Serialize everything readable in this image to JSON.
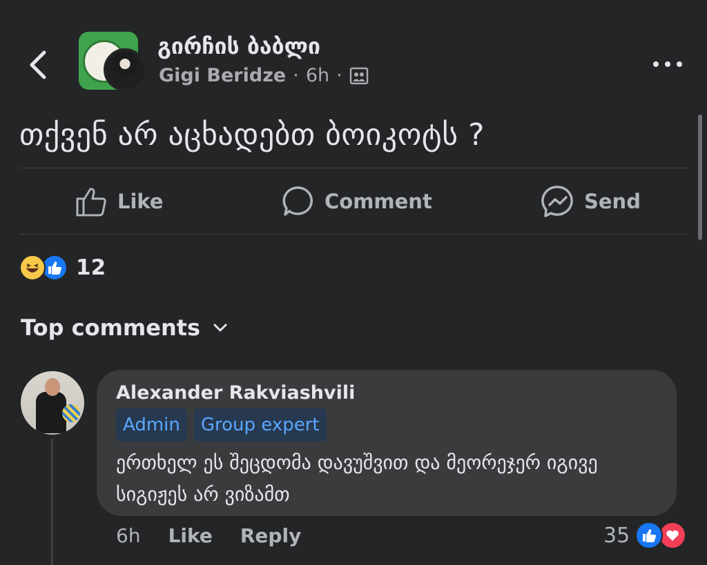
{
  "header": {
    "group_name": "გირჩის ბაბლი",
    "author_name": "Gigi Beridze",
    "separator": "·",
    "post_age": "6h"
  },
  "post": {
    "text": "თქვენ არ აცხადებთ ბოიკოტს ?"
  },
  "actions": {
    "like_label": "Like",
    "comment_label": "Comment",
    "send_label": "Send"
  },
  "reactions": {
    "count": "12",
    "types": [
      "haha",
      "like"
    ]
  },
  "comments_section": {
    "sort_label": "Top comments"
  },
  "comment": {
    "author": "Alexander Rakviashvili",
    "badges": [
      "Admin",
      "Group expert"
    ],
    "text": "ერთხელ ეს შეცდომა დავუშვით და მეორეჯერ იგივე სიგიჟეს არ ვიზამთ",
    "time": "6h",
    "like_label": "Like",
    "reply_label": "Reply",
    "reaction_count": "35",
    "reaction_types": [
      "like",
      "love"
    ]
  },
  "colors": {
    "background": "#242526",
    "bubble": "#3a3b3c",
    "badge_bg": "#263951",
    "badge_text": "#5aa7ff",
    "like_blue": "#1877f2",
    "love_red": "#f33e58"
  }
}
